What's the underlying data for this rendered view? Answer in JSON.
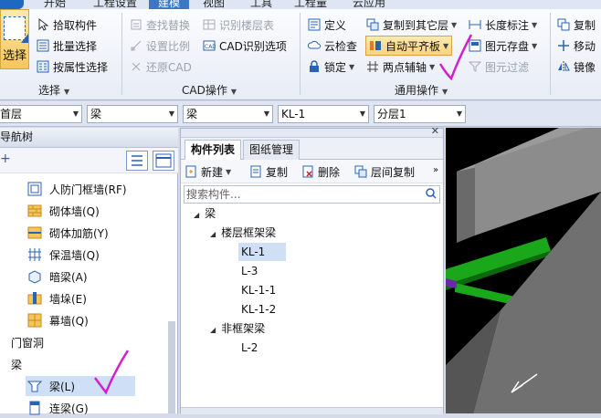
{
  "menu_tabs": [
    {
      "label": "开始",
      "active": false
    },
    {
      "label": "工程设置",
      "active": false
    },
    {
      "label": "建模",
      "active": true
    },
    {
      "label": "视图",
      "active": false
    },
    {
      "label": "工具",
      "active": false
    },
    {
      "label": "工程量",
      "active": false
    },
    {
      "label": "云应用",
      "active": false
    }
  ],
  "ribbon": {
    "select_group": {
      "label": "选择",
      "select_button": "选择",
      "items": [
        "拾取构件",
        "批量选择",
        "按属性选择"
      ]
    },
    "cad_group": {
      "label": "CAD操作",
      "items": [
        "查找替换",
        "识别楼层表",
        "设置比例",
        "CAD识别选项",
        "还原CAD"
      ]
    },
    "common_group": {
      "label": "通用操作",
      "items": [
        "定义",
        "复制到其它层",
        "长度标注",
        "云检查",
        "自动平齐板",
        "图元存盘",
        "锁定",
        "两点辅轴",
        "图元过滤"
      ]
    },
    "right_group": {
      "items": [
        "复制",
        "移动",
        "镜像"
      ]
    }
  },
  "toolbar": {
    "floor": "首层",
    "category": "梁",
    "type": "梁",
    "component": "KL-1",
    "layer": "分层1"
  },
  "nav": {
    "title": "导航树",
    "items": [
      {
        "label": "人防门框墙(RF)",
        "indent": 2
      },
      {
        "label": "砌体墙(Q)",
        "indent": 2
      },
      {
        "label": "砌体加筋(Y)",
        "indent": 2
      },
      {
        "label": "保温墙(Q)",
        "indent": 2
      },
      {
        "label": "暗梁(A)",
        "indent": 2
      },
      {
        "label": "墙垛(E)",
        "indent": 2
      },
      {
        "label": "幕墙(Q)",
        "indent": 2
      },
      {
        "label": "门窗洞",
        "indent": 1
      },
      {
        "label": "梁",
        "indent": 1
      },
      {
        "label": "梁(L)",
        "indent": 2,
        "selected": true
      },
      {
        "label": "连梁(G)",
        "indent": 2
      }
    ]
  },
  "components": {
    "tabs": [
      "构件列表",
      "图纸管理"
    ],
    "toolbar": [
      "新建",
      "复制",
      "删除",
      "层间复制"
    ],
    "search_placeholder": "搜索构件...",
    "tree": {
      "root": "梁",
      "groups": [
        {
          "label": "楼层框架梁",
          "items": [
            "KL-1",
            "L-3",
            "KL-1-1",
            "KL-1-2"
          ]
        },
        {
          "label": "非框架梁",
          "items": [
            "L-2"
          ]
        }
      ]
    }
  },
  "colors": {
    "accent": "#3b77c7",
    "annotation": "#d020d0",
    "beam_green": "#1aa81a"
  }
}
